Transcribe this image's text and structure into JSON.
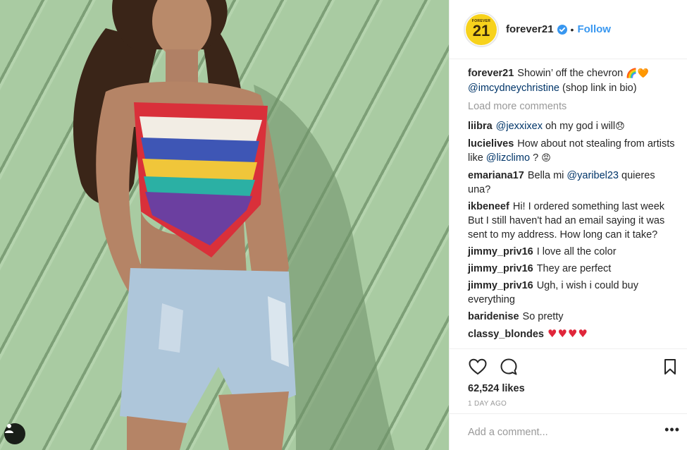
{
  "header": {
    "avatar_top": "FOREVER",
    "avatar_num": "21",
    "username": "forever21",
    "separator": "•",
    "follow_label": "Follow"
  },
  "caption": {
    "user": "forever21",
    "text": "Showin’ off the chevron",
    "emoji": "🌈🧡",
    "mention": "@imcydneychristine",
    "suffix": "(shop link in bio)"
  },
  "load_more": "Load more comments",
  "comments": [
    {
      "user": "liibra",
      "mention": "@jexxixex",
      "text": "oh my god i will",
      "emoji": "😞"
    },
    {
      "user": "lucielives",
      "text": "How about not stealing from artists like",
      "mention": "@lizclimo",
      "suffix": "?",
      "emoji": "😡"
    },
    {
      "user": "emariana17",
      "text": "Bella mi",
      "mention": "@yaribel23",
      "suffix": "quieres una?"
    },
    {
      "user": "ikbeneef",
      "text": "Hi! I ordered something last week But I still haven't had an email saying it was sent to my address. How long can it take?"
    },
    {
      "user": "jimmy_priv16",
      "text": "I love all the color"
    },
    {
      "user": "jimmy_priv16",
      "text": "They are perfect"
    },
    {
      "user": "jimmy_priv16",
      "text": "Ugh, i wish i could buy everything"
    },
    {
      "user": "baridenise",
      "text": "So pretty"
    },
    {
      "user": "classy_blondes",
      "emoji": "♥♥♥♥"
    }
  ],
  "stats": {
    "likes": "62,524 likes",
    "time": "1 DAY AGO"
  },
  "add_comment": {
    "placeholder": "Add a comment...",
    "more_label": "•••"
  },
  "colors": {
    "accent": "#3897f0",
    "mention": "#003569",
    "muted": "#999999",
    "brand_yellow": "#f7d21c"
  }
}
